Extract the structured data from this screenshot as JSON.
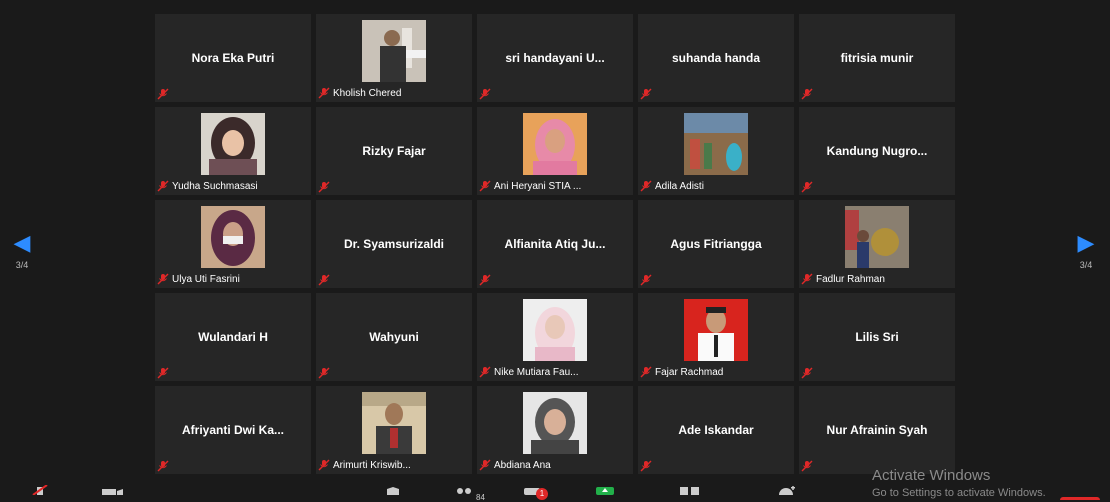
{
  "navigation": {
    "left_arrow": "◀",
    "right_arrow": "▶",
    "page_left": "3/4",
    "page_right": "3/4"
  },
  "tiles": [
    {
      "name": "Nora Eka Putri"
    },
    {
      "caption": "Kholish Chered"
    },
    {
      "name": "sri  handayani  U..."
    },
    {
      "name": "suhanda handa"
    },
    {
      "name": "fitrisia munir"
    },
    {
      "caption": "Yudha Suchmasasi"
    },
    {
      "name": "Rizky Fajar"
    },
    {
      "caption": "Ani Heryani STIA ..."
    },
    {
      "caption": "Adila Adisti"
    },
    {
      "name": "Kandung  Nugro..."
    },
    {
      "caption": "Ulya Uti Fasrini"
    },
    {
      "name": "Dr. Syamsurizaldi"
    },
    {
      "name": "Alfianita  Atiq  Ju..."
    },
    {
      "name": "Agus Fitriangga"
    },
    {
      "caption": "Fadlur Rahman"
    },
    {
      "name": "Wulandari H"
    },
    {
      "name": "Wahyuni"
    },
    {
      "caption": "Nike Mutiara Fau..."
    },
    {
      "caption": "Fajar Rachmad"
    },
    {
      "name": "Lilis Sri"
    },
    {
      "name": "Afriyanti  Dwi  Ka..."
    },
    {
      "caption": "Arimurti Kriswib..."
    },
    {
      "caption": "Abdiana Ana"
    },
    {
      "name": "Ade Iskandar"
    },
    {
      "name": "Nur Afrainin Syah"
    }
  ],
  "watermark": {
    "line1": "Activate Windows",
    "line2": "Go to Settings to activate Windows."
  },
  "toolbar": {
    "participants_count": "84",
    "chat_badge": "1"
  },
  "colors": {
    "background": "#1a1a1a",
    "tile": "#262626",
    "muted_icon": "#e02828",
    "nav_arrow": "#2d8cff"
  }
}
